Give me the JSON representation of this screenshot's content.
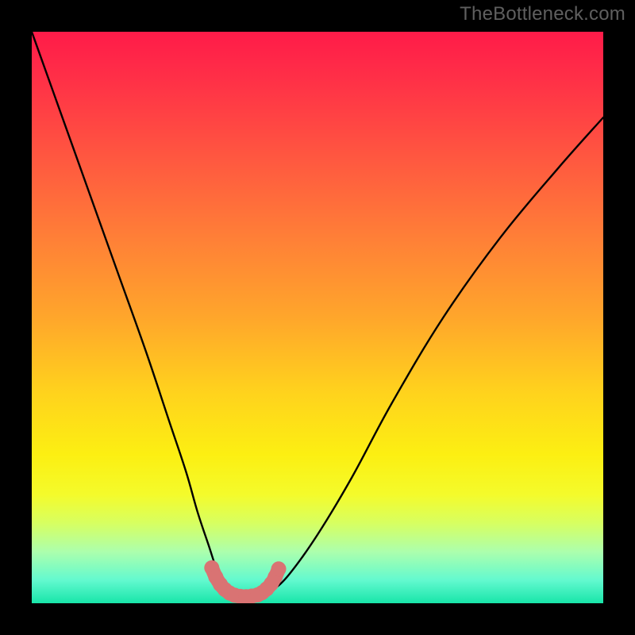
{
  "watermark": "TheBottleneck.com",
  "chart_data": {
    "type": "line",
    "title": "",
    "xlabel": "",
    "ylabel": "",
    "xlim": [
      0,
      100
    ],
    "ylim": [
      0,
      100
    ],
    "grid": false,
    "series": [
      {
        "name": "bottleneck-curve",
        "color": "#000000",
        "x": [
          0,
          5,
          10,
          15,
          20,
          24,
          27,
          29,
          31,
          32.5,
          34,
          36,
          38,
          40,
          42,
          45,
          50,
          56,
          63,
          72,
          82,
          92,
          100
        ],
        "values": [
          100,
          86,
          72,
          58,
          44,
          32,
          23,
          16,
          10,
          5.5,
          2.5,
          1.2,
          1.0,
          1.2,
          2.2,
          5,
          12,
          22,
          35,
          50,
          64,
          76,
          85
        ]
      },
      {
        "name": "bottom-marker",
        "color": "#d97373",
        "x": [
          31.5,
          32.2,
          33.0,
          33.8,
          34.6,
          35.5,
          36.5,
          37.5,
          38.5,
          39.5,
          40.3,
          41.1,
          41.9,
          42.6,
          43.2
        ],
        "values": [
          6.2,
          4.6,
          3.3,
          2.4,
          1.8,
          1.4,
          1.2,
          1.15,
          1.25,
          1.45,
          1.85,
          2.5,
          3.4,
          4.6,
          6.0
        ]
      }
    ],
    "annotations": []
  }
}
